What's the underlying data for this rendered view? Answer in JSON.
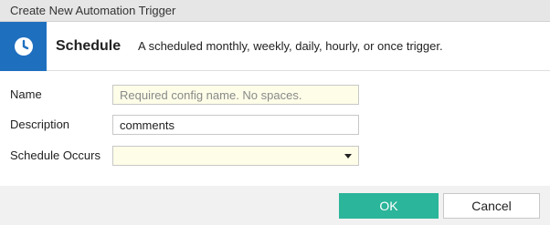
{
  "dialog": {
    "title": "Create New Automation Trigger"
  },
  "header": {
    "icon": "clock-icon",
    "accent_color": "#1f6fbf",
    "title": "Schedule",
    "description": "A scheduled monthly, weekly, daily, hourly, or once trigger."
  },
  "form": {
    "name": {
      "label": "Name",
      "value": "",
      "placeholder": "Required config name. No spaces."
    },
    "description": {
      "label": "Description",
      "value": "comments"
    },
    "schedule": {
      "label": "Schedule Occurs",
      "selected": ""
    }
  },
  "buttons": {
    "ok_label": "OK",
    "ok_color": "#2bb59a",
    "cancel_label": "Cancel"
  }
}
